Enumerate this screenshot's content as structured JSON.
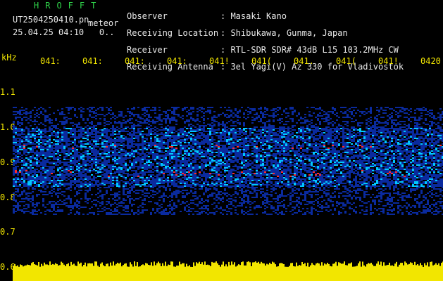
{
  "header": {
    "brand": "HROFFT",
    "filename": "UT2504250410.pn",
    "suffix": "meteor",
    "datetime": "25.04.25 04:10",
    "datetime_extra": "0..",
    "fields": [
      {
        "label": "Observer",
        "value": ": Masaki Kano"
      },
      {
        "label": "Receiving Location",
        "value": ": Shibukawa, Gunma, Japan"
      },
      {
        "label": "Receiver",
        "value": ": RTL-SDR SDR# 43dB L15 103.2MHz CW"
      },
      {
        "label": "Receiving Antenna",
        "value": ": 3el Yagi(V) Az 330 for Vladivostok"
      }
    ]
  },
  "axes": {
    "y_unit": "kHz",
    "y_ticks": [
      "1.1",
      "1.0",
      "0.9",
      "0.8",
      "0.7",
      "0.6"
    ],
    "x_ticks": [
      "041:",
      "041:",
      "041:",
      "041:",
      "041!",
      "041(",
      "041.",
      "041(",
      "041!",
      "0420"
    ]
  },
  "colors": {
    "background": "#000000",
    "text_green": "#2fd44a",
    "text_white": "#e8e8e8",
    "axis_yellow": "#f2e600",
    "band_low": "#0a2a9e",
    "band_mid": "#00c8ff",
    "band_high": "#ff2a2a"
  }
}
